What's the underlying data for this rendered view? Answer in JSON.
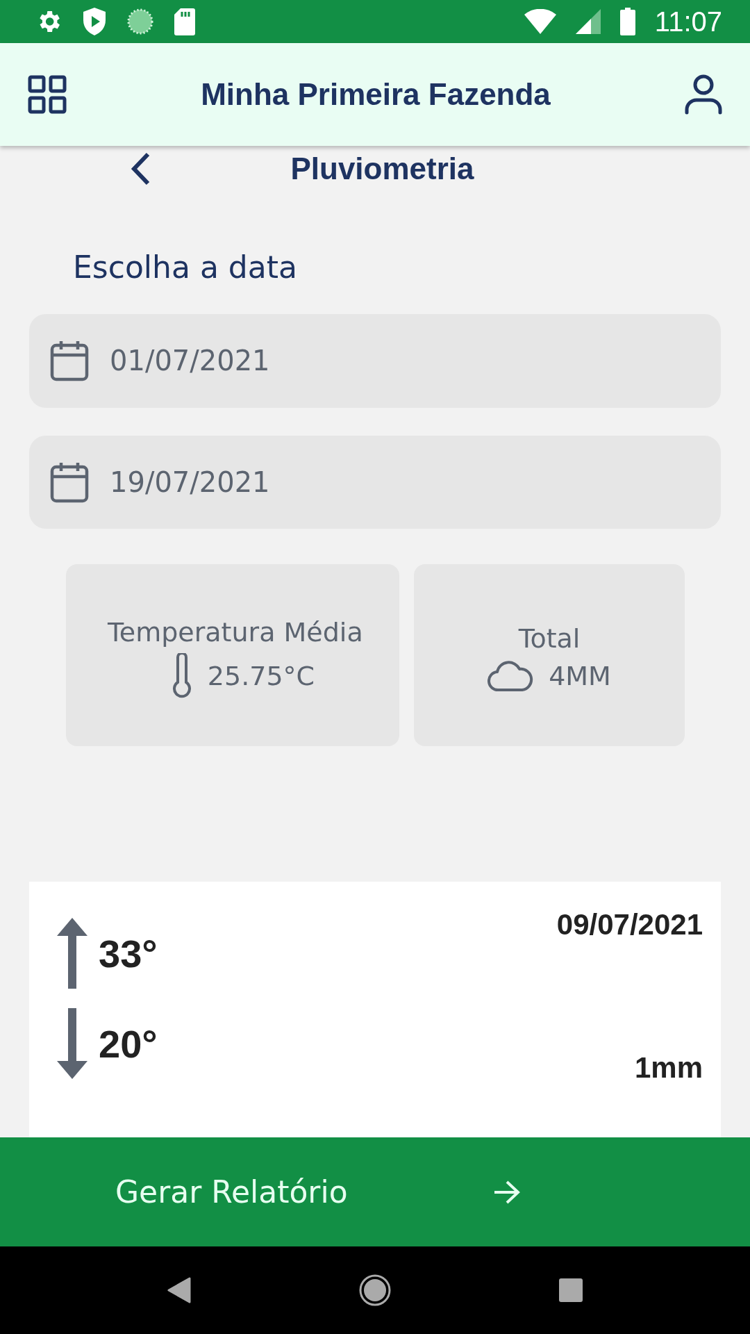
{
  "status_bar": {
    "time": "11:07"
  },
  "header": {
    "title": "Minha Primeira Fazenda"
  },
  "page": {
    "title": "Pluviometria"
  },
  "date_section": {
    "label": "Escolha a data",
    "fields": [
      {
        "value": "01/07/2021"
      },
      {
        "value": "19/07/2021"
      }
    ]
  },
  "summary_cards": [
    {
      "kind": "temperature",
      "title": "Temperatura Média",
      "value": "25.75°C"
    },
    {
      "kind": "rain",
      "title": "Total",
      "value": "4MM"
    }
  ],
  "daily": [
    {
      "max": "33°",
      "min": "20°",
      "date": "09/07/2021",
      "rain": "1mm"
    }
  ],
  "action_button": {
    "label": "Gerar Relatório"
  }
}
